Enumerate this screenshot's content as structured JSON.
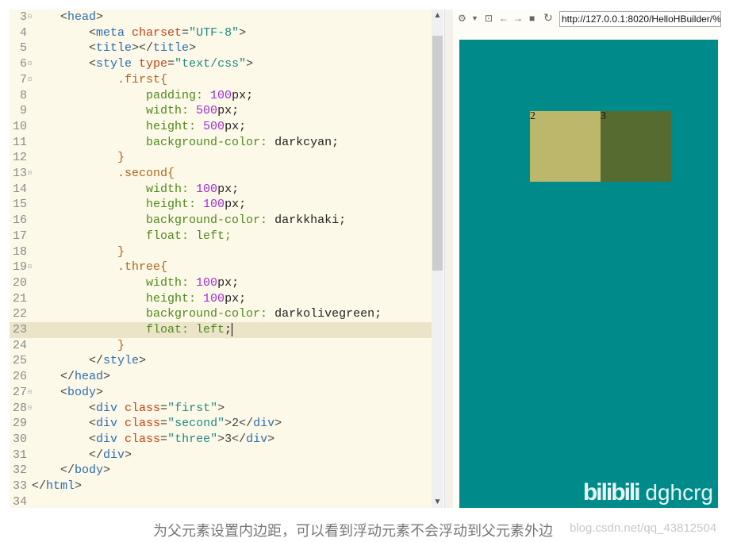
{
  "editor": {
    "highlight_line": 23,
    "lines": [
      {
        "n": "3",
        "fold": true,
        "tok": [
          [
            "p",
            "    <"
          ],
          [
            "t",
            "head"
          ],
          [
            "p",
            ">"
          ]
        ]
      },
      {
        "n": "4",
        "tok": [
          [
            "p",
            "        <"
          ],
          [
            "t",
            "meta "
          ],
          [
            "a",
            "charset"
          ],
          [
            "p",
            "="
          ],
          [
            "s",
            "\"UTF-8\""
          ],
          [
            "p",
            ">"
          ]
        ]
      },
      {
        "n": "5",
        "tok": [
          [
            "p",
            "        <"
          ],
          [
            "t",
            "title"
          ],
          [
            "p",
            "></"
          ],
          [
            "t",
            "title"
          ],
          [
            "p",
            ">"
          ]
        ]
      },
      {
        "n": "6",
        "fold": true,
        "tok": [
          [
            "p",
            "        <"
          ],
          [
            "t",
            "style "
          ],
          [
            "a",
            "type"
          ],
          [
            "p",
            "="
          ],
          [
            "s",
            "\"text/css\""
          ],
          [
            "p",
            ">"
          ]
        ]
      },
      {
        "n": "7",
        "fold": true,
        "tok": [
          [
            "sel",
            "            .first{"
          ]
        ]
      },
      {
        "n": "8",
        "tok": [
          [
            "pr",
            "                padding: "
          ],
          [
            "n",
            "100"
          ],
          [
            "v",
            "px;"
          ]
        ]
      },
      {
        "n": "9",
        "tok": [
          [
            "pr",
            "                width: "
          ],
          [
            "n",
            "500"
          ],
          [
            "v",
            "px;"
          ]
        ]
      },
      {
        "n": "10",
        "tok": [
          [
            "pr",
            "                height: "
          ],
          [
            "n",
            "500"
          ],
          [
            "v",
            "px;"
          ]
        ]
      },
      {
        "n": "11",
        "tok": [
          [
            "pr",
            "                background-color: "
          ],
          [
            "v",
            "darkcyan;"
          ]
        ]
      },
      {
        "n": "12",
        "tok": [
          [
            "sel",
            "            }"
          ]
        ]
      },
      {
        "n": "13",
        "fold": true,
        "tok": [
          [
            "sel",
            "            .second{"
          ]
        ]
      },
      {
        "n": "14",
        "tok": [
          [
            "pr",
            "                width: "
          ],
          [
            "n",
            "100"
          ],
          [
            "v",
            "px;"
          ]
        ]
      },
      {
        "n": "15",
        "tok": [
          [
            "pr",
            "                height: "
          ],
          [
            "n",
            "100"
          ],
          [
            "v",
            "px;"
          ]
        ]
      },
      {
        "n": "16",
        "tok": [
          [
            "pr",
            "                background-color: "
          ],
          [
            "v",
            "darkkhaki;"
          ]
        ]
      },
      {
        "n": "17",
        "tok": [
          [
            "pr",
            "                float: left;"
          ]
        ]
      },
      {
        "n": "18",
        "tok": [
          [
            "sel",
            "            }"
          ]
        ]
      },
      {
        "n": "19",
        "fold": true,
        "tok": [
          [
            "sel",
            "            .three{"
          ]
        ]
      },
      {
        "n": "20",
        "tok": [
          [
            "pr",
            "                width: "
          ],
          [
            "n",
            "100"
          ],
          [
            "v",
            "px;"
          ]
        ]
      },
      {
        "n": "21",
        "tok": [
          [
            "pr",
            "                height: "
          ],
          [
            "n",
            "100"
          ],
          [
            "v",
            "px;"
          ]
        ]
      },
      {
        "n": "22",
        "tok": [
          [
            "pr",
            "                background-color: "
          ],
          [
            "v",
            "darkolivegreen;"
          ]
        ]
      },
      {
        "n": "23",
        "tok": [
          [
            "pr",
            "                float: left"
          ],
          [
            "v",
            ";"
          ]
        ]
      },
      {
        "n": "24",
        "tok": [
          [
            "sel",
            "            }"
          ]
        ]
      },
      {
        "n": "25",
        "tok": [
          [
            "p",
            "        </"
          ],
          [
            "t",
            "style"
          ],
          [
            "p",
            ">"
          ]
        ]
      },
      {
        "n": "26",
        "tok": [
          [
            "p",
            "    </"
          ],
          [
            "t",
            "head"
          ],
          [
            "p",
            ">"
          ]
        ]
      },
      {
        "n": "27",
        "fold": true,
        "tok": [
          [
            "p",
            "    <"
          ],
          [
            "t",
            "body"
          ],
          [
            "p",
            ">"
          ]
        ]
      },
      {
        "n": "28",
        "fold": true,
        "tok": [
          [
            "p",
            "        <"
          ],
          [
            "t",
            "div "
          ],
          [
            "a",
            "class"
          ],
          [
            "p",
            "="
          ],
          [
            "s",
            "\"first\""
          ],
          [
            "p",
            ">"
          ]
        ]
      },
      {
        "n": "29",
        "tok": [
          [
            "p",
            "        <"
          ],
          [
            "t",
            "div "
          ],
          [
            "a",
            "class"
          ],
          [
            "p",
            "="
          ],
          [
            "s",
            "\"second\""
          ],
          [
            "p",
            ">2</"
          ],
          [
            "t",
            "div"
          ],
          [
            "p",
            ">"
          ]
        ]
      },
      {
        "n": "30",
        "tok": [
          [
            "p",
            "        <"
          ],
          [
            "t",
            "div "
          ],
          [
            "a",
            "class"
          ],
          [
            "p",
            "="
          ],
          [
            "s",
            "\"three\""
          ],
          [
            "p",
            ">3</"
          ],
          [
            "t",
            "div"
          ],
          [
            "p",
            ">"
          ]
        ]
      },
      {
        "n": "31",
        "tok": [
          [
            "p",
            "        </"
          ],
          [
            "t",
            "div"
          ],
          [
            "p",
            ">"
          ]
        ]
      },
      {
        "n": "32",
        "tok": [
          [
            "p",
            "    </"
          ],
          [
            "t",
            "body"
          ],
          [
            "p",
            ">"
          ]
        ]
      },
      {
        "n": "33",
        "tok": [
          [
            "p",
            "</"
          ],
          [
            "t",
            "html"
          ],
          [
            "p",
            ">"
          ]
        ]
      },
      {
        "n": "34",
        "tok": []
      }
    ]
  },
  "browser": {
    "toolbar_icons": [
      "settings-icon",
      "dropdown-icon",
      "console-icon",
      "back-icon",
      "forward-icon",
      "stop-icon",
      "reload-icon"
    ],
    "url": "http://127.0.0.1:8020/HelloHBuilder/%",
    "viewport_bg": "#008b8b",
    "boxes": [
      {
        "label": "2",
        "color": "#bdb76b"
      },
      {
        "label": "3",
        "color": "#556b2f"
      }
    ],
    "watermark": {
      "logo": "bilibili",
      "user": "dghcrg"
    }
  },
  "caption": "为父元素设置内边距，可以看到浮动元素不会浮动到父元素外边",
  "csdn_watermark": "blog.csdn.net/qq_43812504"
}
